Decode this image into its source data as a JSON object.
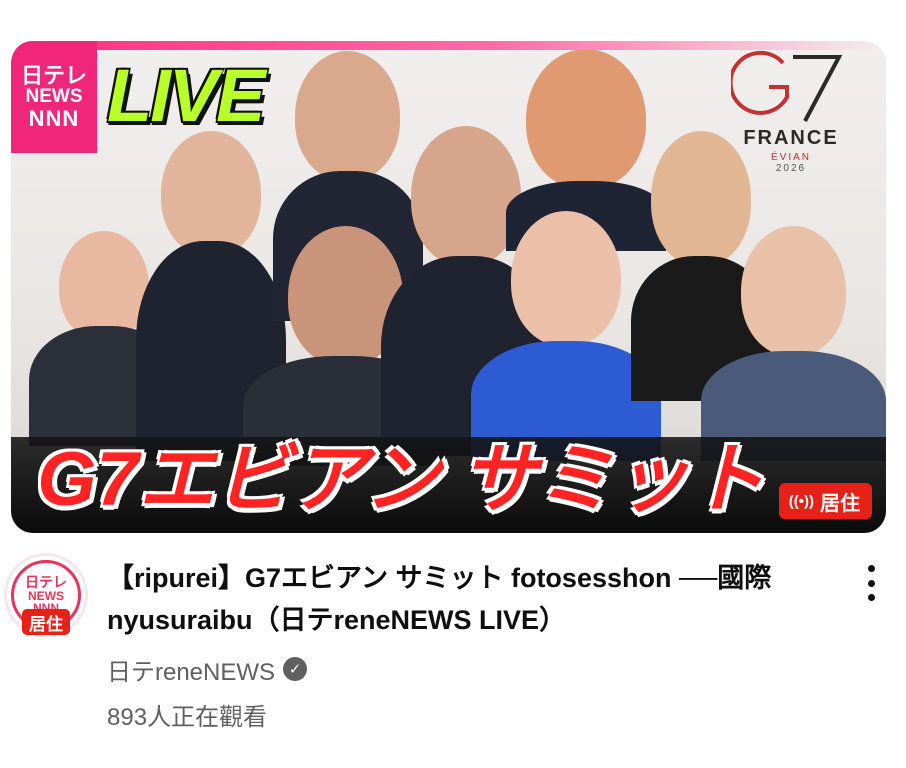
{
  "thumbnail": {
    "ntv_logo": {
      "line1": "日テレ",
      "line2": "NEWS",
      "line3": "NNN"
    },
    "live_text": "LIVE",
    "g7_logo": {
      "mark": "G7",
      "country": "FRANCE",
      "city": "ÉVIAN",
      "year": "2026"
    },
    "headline": "G7エビアン サミット",
    "live_badge": {
      "icon": "broadcast-icon",
      "label": "居住"
    }
  },
  "video": {
    "title": "【ripurei】G7エビアン サミット fotosesshon ──國際nyusuraibu（日テreneNEWS LIVE）",
    "channel_name": "日テreneNEWS",
    "verified_icon": "check-icon",
    "viewers": "893人正在觀看"
  },
  "avatar": {
    "line1": "日テレ",
    "line2": "NEWS",
    "line3": "NNN",
    "live_label": "居住"
  },
  "colors": {
    "live_red": "#e62117",
    "ntv_pink": "#f0267b",
    "live_green": "#b8ff2a",
    "headline_red": "#ff2323",
    "meta_gray": "#606060"
  }
}
